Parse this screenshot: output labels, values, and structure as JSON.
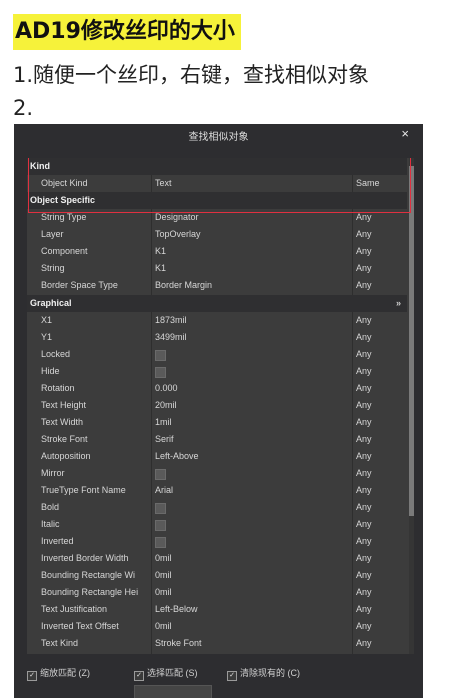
{
  "article": {
    "heading": "AD19修改丝印的大小",
    "step1": "1.随便一个丝印，右键，查找相似对象",
    "step2": "2."
  },
  "dialog": {
    "title": "查找相似对象",
    "close": "×",
    "categories": {
      "kind": "Kind",
      "object_specific": "Object Specific",
      "graphical": "Graphical"
    },
    "rows": [
      {
        "name": "Object Kind",
        "value": "Text",
        "match": "Same"
      },
      {
        "name": "String Type",
        "value": "Designator",
        "match": "Any"
      },
      {
        "name": "Layer",
        "value": "TopOverlay",
        "match": "Any"
      },
      {
        "name": "Component",
        "value": "K1",
        "match": "Any"
      },
      {
        "name": "String",
        "value": "K1",
        "match": "Any"
      },
      {
        "name": "Border Space Type",
        "value": "Border Margin",
        "match": "Any"
      },
      {
        "name": "X1",
        "value": "1873mil",
        "match": "Any"
      },
      {
        "name": "Y1",
        "value": "3499mil",
        "match": "Any"
      },
      {
        "name": "Locked",
        "value": "",
        "match": "Any"
      },
      {
        "name": "Hide",
        "value": "",
        "match": "Any"
      },
      {
        "name": "Rotation",
        "value": "0.000",
        "match": "Any"
      },
      {
        "name": "Text Height",
        "value": "20mil",
        "match": "Any"
      },
      {
        "name": "Text Width",
        "value": "1mil",
        "match": "Any"
      },
      {
        "name": "Stroke Font",
        "value": "Serif",
        "match": "Any"
      },
      {
        "name": "Autoposition",
        "value": "Left-Above",
        "match": "Any"
      },
      {
        "name": "Mirror",
        "value": "",
        "match": "Any"
      },
      {
        "name": "TrueType Font Name",
        "value": "Arial",
        "match": "Any"
      },
      {
        "name": "Bold",
        "value": "",
        "match": "Any"
      },
      {
        "name": "Italic",
        "value": "",
        "match": "Any"
      },
      {
        "name": "Inverted",
        "value": "",
        "match": "Any"
      },
      {
        "name": "Inverted Border Width",
        "value": "0mil",
        "match": "Any"
      },
      {
        "name": "Bounding Rectangle Wi",
        "value": "0mil",
        "match": "Any"
      },
      {
        "name": "Bounding Rectangle Hei",
        "value": "0mil",
        "match": "Any"
      },
      {
        "name": "Text Justification",
        "value": "Left-Below",
        "match": "Any"
      },
      {
        "name": "Inverted Text Offset",
        "value": "0mil",
        "match": "Any"
      },
      {
        "name": "Text Kind",
        "value": "Stroke Font",
        "match": "Any"
      }
    ],
    "options": {
      "zoom_match": "缩放匹配 (Z)",
      "select_match": "选择匹配 (S)",
      "clear_existing": "清除现有的 (C)"
    },
    "colors": {
      "highlight": "#e03040",
      "heading_bg": "#f6f23a"
    }
  }
}
